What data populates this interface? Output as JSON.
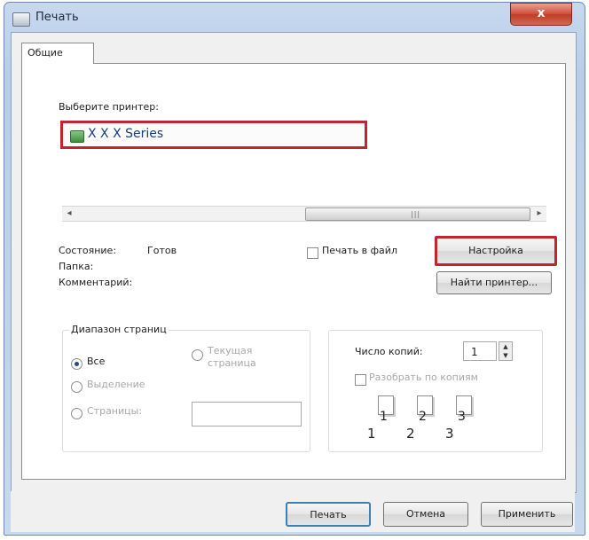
{
  "window": {
    "title": "Печать",
    "close_glyph": "x"
  },
  "tabs": [
    {
      "label": "Общие"
    }
  ],
  "printer_section": {
    "label": "Выберите принтер:",
    "printers": [
      {
        "name": "X X X Series",
        "icon": "printer-icon",
        "selected": true
      }
    ]
  },
  "status": {
    "state_label": "Состояние:",
    "state_value": "Готов",
    "folder_label": "Папка:",
    "comment_label": "Комментарий:"
  },
  "print_to_file": {
    "label": "Печать в файл",
    "checked": false
  },
  "buttons": {
    "settings": "Настройка",
    "find_printer": "Найти принтер...",
    "print": "Печать",
    "cancel": "Отмена",
    "apply": "Применить"
  },
  "page_range": {
    "title": "Диапазон страниц",
    "all": "Все",
    "selection": "Выделение",
    "current_page": "Текущая страница",
    "pages": "Страницы:",
    "pages_value": "",
    "selected_option": "all"
  },
  "copies": {
    "label": "Число копий:",
    "value": "1",
    "collate_label": "Разобрать по копиям",
    "collate_checked": false,
    "collate_preview": [
      "1",
      "1",
      "2",
      "2",
      "3",
      "3"
    ]
  },
  "colors": {
    "highlight": "#c0262d",
    "window_frame": "#b7cde8"
  }
}
